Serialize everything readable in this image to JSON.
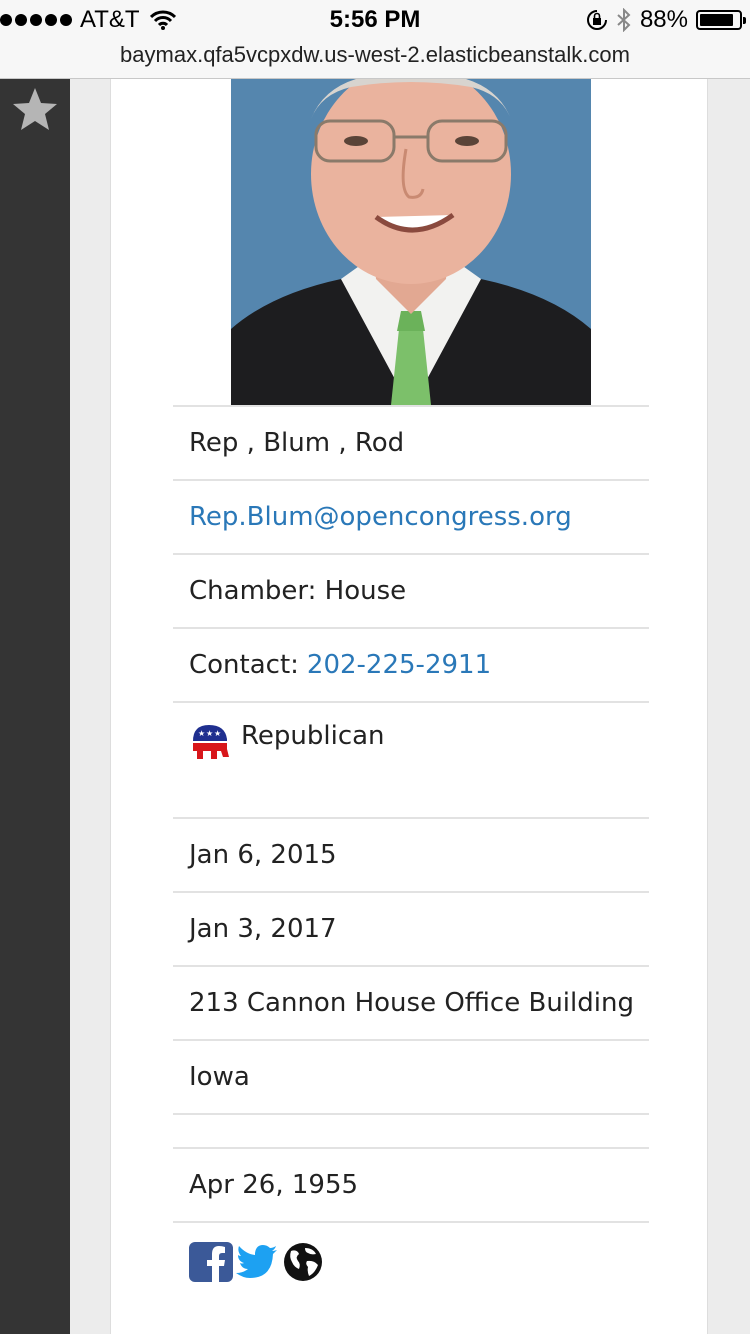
{
  "status_bar": {
    "carrier": "AT&T",
    "time": "5:56 PM",
    "battery": "88%",
    "battery_level": 0.88
  },
  "browser": {
    "url": "baymax.qfa5vcpxdw.us-west-2.elasticbeanstalk.com"
  },
  "profile": {
    "name": "Rep , Blum , Rod",
    "email": "Rep.Blum@opencongress.org",
    "chamber": "Chamber: House",
    "contact_label": "Contact:",
    "phone": "202-225-2911",
    "party": "Republican",
    "term_start": "Jan 6, 2015",
    "term_end": "Jan 3, 2017",
    "office": "213 Cannon House Office Building",
    "state": "Iowa",
    "birthday": "Apr 26, 1955"
  },
  "icons": [
    "star-icon",
    "republican-elephant-icon",
    "facebook-icon",
    "twitter-icon",
    "globe-icon"
  ],
  "colors": {
    "sidebar": "#343434",
    "link": "#2a78b8",
    "facebook": "#3b5998",
    "twitter": "#1da1f2"
  }
}
